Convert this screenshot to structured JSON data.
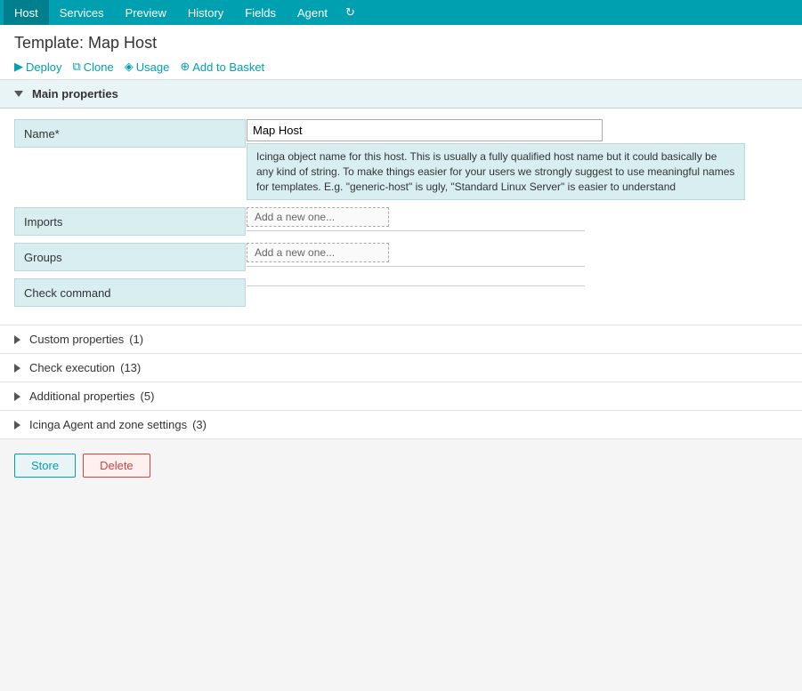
{
  "nav": {
    "items": [
      {
        "id": "host",
        "label": "Host",
        "active": true
      },
      {
        "id": "services",
        "label": "Services",
        "active": false
      },
      {
        "id": "preview",
        "label": "Preview",
        "active": false
      },
      {
        "id": "history",
        "label": "History",
        "active": false
      },
      {
        "id": "fields",
        "label": "Fields",
        "active": false
      },
      {
        "id": "agent",
        "label": "Agent",
        "active": false
      }
    ]
  },
  "page": {
    "title": "Template: Map Host"
  },
  "actions": {
    "deploy": "Deploy",
    "clone": "Clone",
    "usage": "Usage",
    "add_to_basket": "Add to Basket"
  },
  "main_properties": {
    "section_label": "Main properties",
    "name_label": "Name*",
    "name_value": "Map Host",
    "name_help": "Icinga object name for this host. This is usually a fully qualified host name but it could basically be any kind of string. To make things easier for your users we strongly suggest to use meaningful names for templates. E.g. \"generic-host\" is ugly, \"Standard Linux Server\" is easier to understand",
    "imports_label": "Imports",
    "imports_placeholder": "Add a new one...",
    "groups_label": "Groups",
    "groups_placeholder": "Add a new one...",
    "check_command_label": "Check command"
  },
  "collapsible_sections": [
    {
      "id": "custom-properties",
      "label": "Custom properties",
      "count": "(1)"
    },
    {
      "id": "check-execution",
      "label": "Check execution",
      "count": "(13)"
    },
    {
      "id": "additional-properties",
      "label": "Additional properties",
      "count": "(5)"
    },
    {
      "id": "icinga-agent",
      "label": "Icinga Agent and zone settings",
      "count": "(3)"
    }
  ],
  "buttons": {
    "store": "Store",
    "delete": "Delete"
  },
  "colors": {
    "nav_bg": "#00a0b0",
    "section_bg": "#e8f4f6",
    "label_bg": "#d9eef1"
  }
}
